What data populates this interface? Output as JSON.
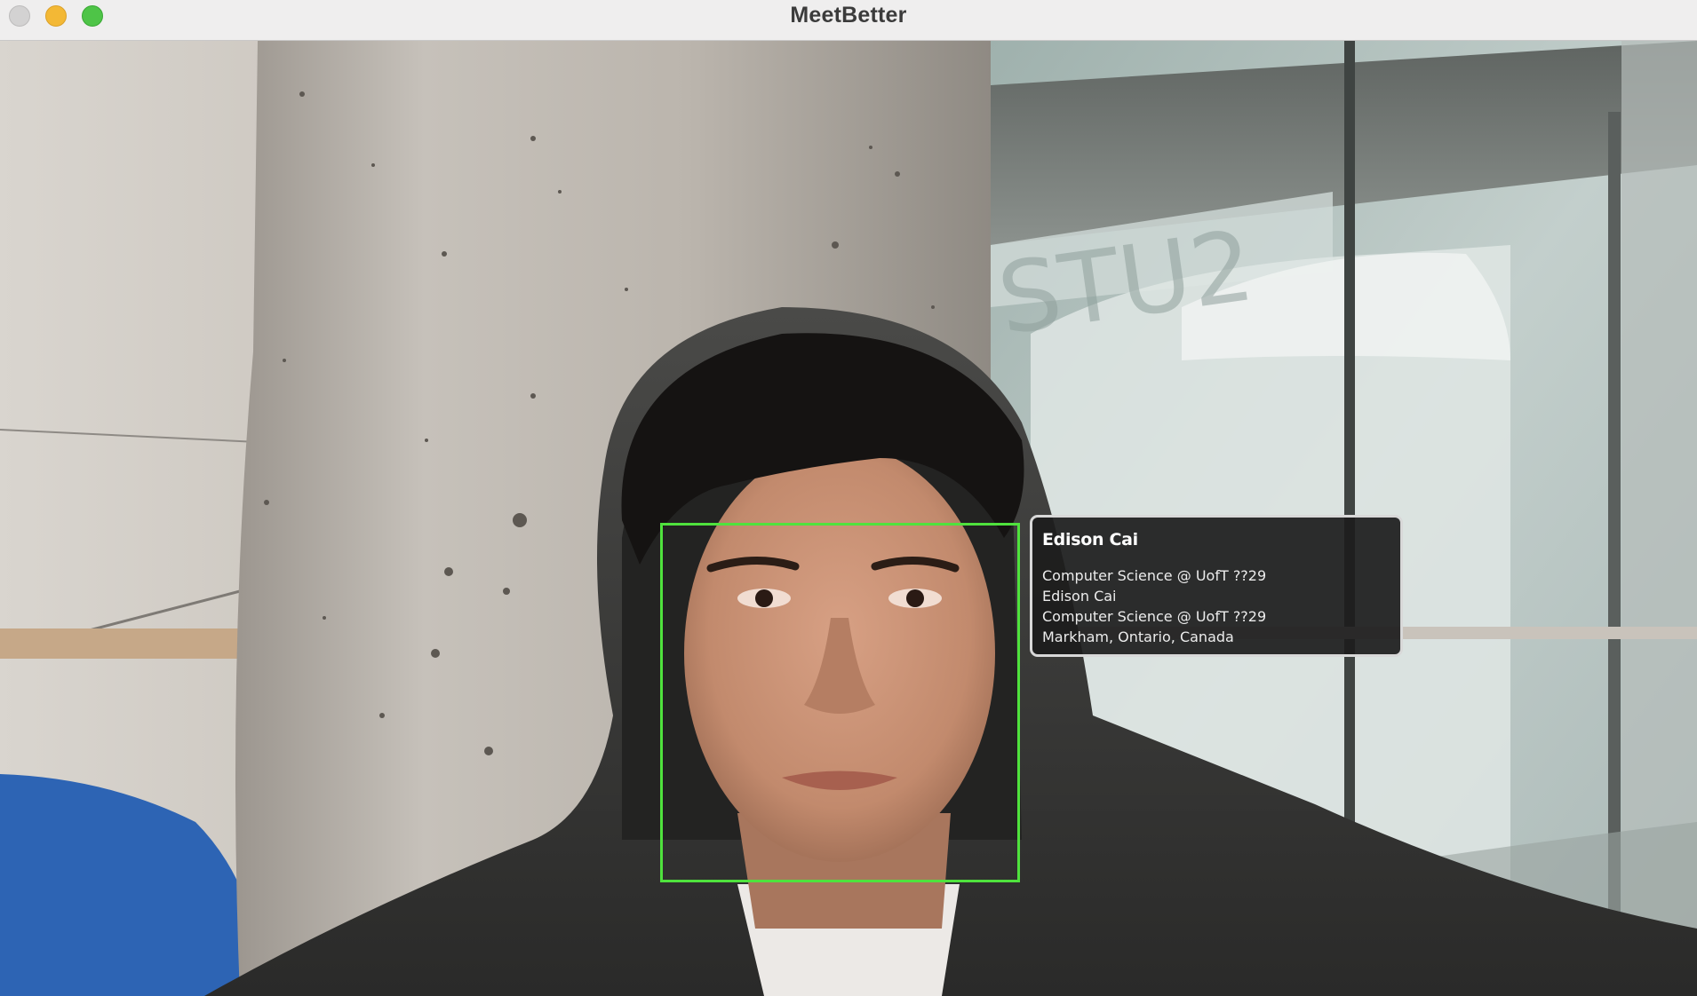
{
  "window": {
    "title": "MeetBetter"
  },
  "traffic_lights": {
    "close": "close",
    "minimize": "minimize",
    "zoom": "zoom"
  },
  "detection": {
    "box_color": "#4fe23d"
  },
  "info_card": {
    "name": "Edison Cai",
    "lines": [
      "Computer Science @ UofT ??29",
      "Edison Cai",
      "Computer Science @ UofT ??29",
      "Markham, Ontario, Canada"
    ]
  },
  "colors": {
    "titlebar_bg": "#efeeee",
    "card_bg": "#1c1c1c",
    "card_border": "#d8d8d8"
  }
}
